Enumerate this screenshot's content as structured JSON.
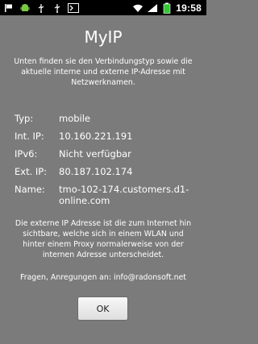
{
  "statusbar": {
    "time": "19:58",
    "icons_left": [
      "flag-icon",
      "android-icon",
      "usb-icon",
      "usb-icon",
      "terminal-icon"
    ],
    "icons_right": [
      "wifi-icon",
      "signal-icon",
      "battery-icon"
    ]
  },
  "dialog": {
    "title": "MyIP",
    "intro": "Unten finden sie den Verbindungstyp sowie die aktuelle interne und externe IP-Adresse mit Netzwerknamen.",
    "rows": [
      {
        "label": "Typ:",
        "value": "mobile"
      },
      {
        "label": "Int. IP:",
        "value": "10.160.221.191"
      },
      {
        "label": "IPv6:",
        "value": "Nicht verfügbar"
      },
      {
        "label": "Ext. IP:",
        "value": "80.187.102.174"
      },
      {
        "label": "Name:",
        "value": "tmo-102-174.customers.d1-online.com"
      }
    ],
    "note": "Die externe IP Adresse ist die zum Internet hin sichtbare, welche sich in einem WLAN und hinter einem Proxy normalerweise von der internen Adresse unterscheidet.",
    "contact": "Fragen, Anregungen an: info@radonsoft.net",
    "ok_label": "OK"
  },
  "colors": {
    "background": "#7b7b7b",
    "statusbar": "#000000",
    "battery": "#34c734"
  }
}
